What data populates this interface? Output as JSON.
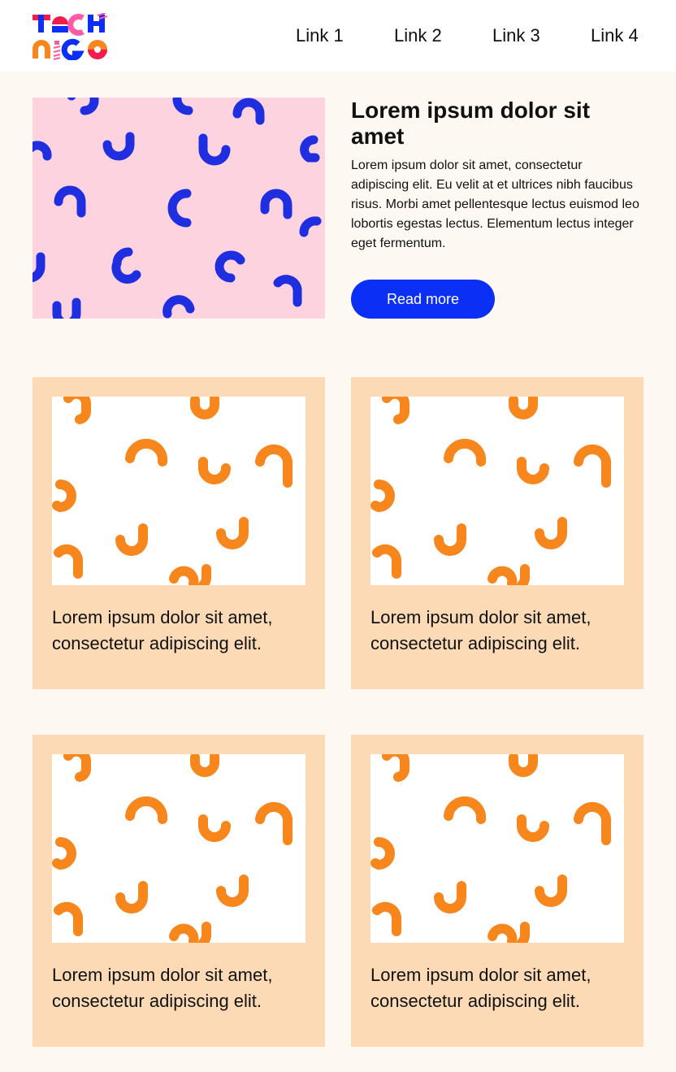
{
  "header": {
    "logo_text": "TECH NIGO",
    "nav": [
      "Link 1",
      "Link 2",
      "Link 3",
      "Link 4"
    ]
  },
  "hero": {
    "title": "Lorem ipsum dolor sit amet",
    "body": "Lorem ipsum dolor sit amet, consectetur adipiscing elit. Eu velit at et ultrices nibh faucibus risus. Morbi amet pellentesque lectus euismod leo lobortis egestas lectus. Elementum lectus integer eget fermentum.",
    "button": "Read more"
  },
  "cards": [
    {
      "caption": "Lorem ipsum dolor sit amet, consectetur adipiscing elit."
    },
    {
      "caption": "Lorem ipsum dolor sit amet, consectetur adipiscing elit."
    },
    {
      "caption": "Lorem ipsum dolor sit amet, consectetur adipiscing elit."
    },
    {
      "caption": "Lorem ipsum dolor sit amet, consectetur adipiscing elit."
    }
  ],
  "colors": {
    "background": "#fdf8f2",
    "accent_blue": "#0b2ff5",
    "hero_pattern_bg": "#fcd3df",
    "card_bg": "#fcdab5",
    "squiggle_orange": "#f7861c",
    "squiggle_blue": "#1f2fe0"
  }
}
